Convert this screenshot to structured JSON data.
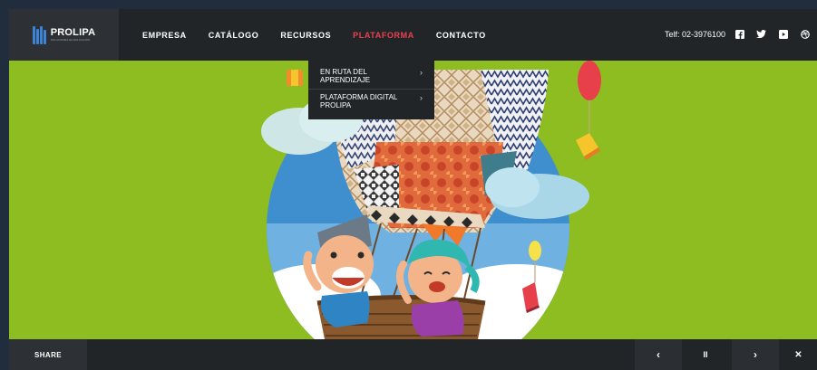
{
  "brand": {
    "name": "PROLIPA",
    "tagline": "SOLUCIONES EN EDUCACIÓN"
  },
  "nav": {
    "items": [
      {
        "label": "EMPRESA"
      },
      {
        "label": "CATÁLOGO"
      },
      {
        "label": "RECURSOS"
      },
      {
        "label": "PLATAFORMA",
        "active": true
      },
      {
        "label": "CONTACTO"
      }
    ]
  },
  "contact": {
    "phone": "Telf: 02-3976100"
  },
  "social": {
    "icons": [
      "facebook-icon",
      "twitter-icon",
      "youtube-icon",
      "dribbble-icon"
    ]
  },
  "dropdown": {
    "items": [
      {
        "label": "EN RUTA DEL APRENDIZAJE",
        "arrow": "›"
      },
      {
        "label": "PLATAFORMA DIGITAL PROLIPA",
        "arrow": "›"
      }
    ]
  },
  "footer": {
    "share_label": "SHARE"
  },
  "slider": {
    "prev": "‹",
    "pause": "II",
    "next": "›",
    "fullscreen": "✕"
  },
  "colors": {
    "hero_bg": "#8dbd20",
    "header_bg": "#222528",
    "accent": "#e8414e",
    "logo_blue": "#3d84d6"
  }
}
